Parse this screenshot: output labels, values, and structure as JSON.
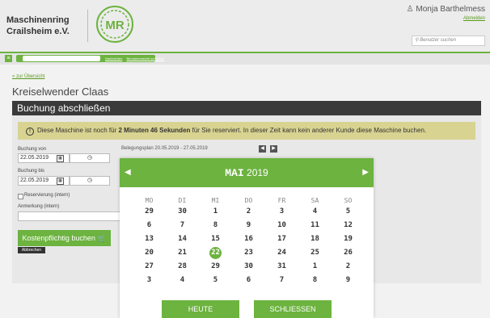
{
  "header": {
    "org_name_line1": "Maschinenring",
    "org_name_line2": "Crailsheim e.V.",
    "emblem_text": "MR",
    "user_name": "Monja Barthelmess",
    "logout": "Abmelden",
    "user_search_placeholder": "Benutzer suchen"
  },
  "nav": {
    "link_1": "Nachrichten",
    "link_2": "Benutzeransicht schließen"
  },
  "page": {
    "back_link": "« zur Übersicht",
    "title": "Kreiselwender Claas",
    "section_title": "Buchung abschließen",
    "alert_prefix": "Diese Maschine ist noch für ",
    "alert_bold": "2 Minuten 46 Sekunden",
    "alert_suffix": " für Sie reserviert. In dieser Zeit kann kein anderer Kunde diese Maschine buchen."
  },
  "form": {
    "from_label": "Buchung von",
    "from_date": "22.05.2019",
    "to_label": "Buchung bis",
    "to_date": "22.05.2019",
    "reservation_label": "Reservierung (intern)",
    "note_label": "Anmerkung (intern)",
    "book_button": "Kostenpflichtig buchen",
    "cancel_button": "Abbrechen",
    "plan_label": "Belegungsplan 20.05.2019 - 27.05.2019"
  },
  "calendar": {
    "month": "MAI",
    "year": "2019",
    "weekdays": [
      "MO",
      "DI",
      "MI",
      "DO",
      "FR",
      "SA",
      "SO"
    ],
    "weeks": [
      [
        "29",
        "30",
        "1",
        "2",
        "3",
        "4",
        "5"
      ],
      [
        "6",
        "7",
        "8",
        "9",
        "10",
        "11",
        "12"
      ],
      [
        "13",
        "14",
        "15",
        "16",
        "17",
        "18",
        "19"
      ],
      [
        "20",
        "21",
        "22",
        "23",
        "24",
        "25",
        "26"
      ],
      [
        "27",
        "28",
        "29",
        "30",
        "31",
        "1",
        "2"
      ],
      [
        "3",
        "4",
        "5",
        "6",
        "7",
        "8",
        "9"
      ]
    ],
    "selected_day": "22",
    "today_button": "HEUTE",
    "close_button": "SCHLIESSEN"
  },
  "colors": {
    "accent": "#6cb33f",
    "section_bar": "#3a3a3a",
    "alert_bg": "#d8d390"
  }
}
